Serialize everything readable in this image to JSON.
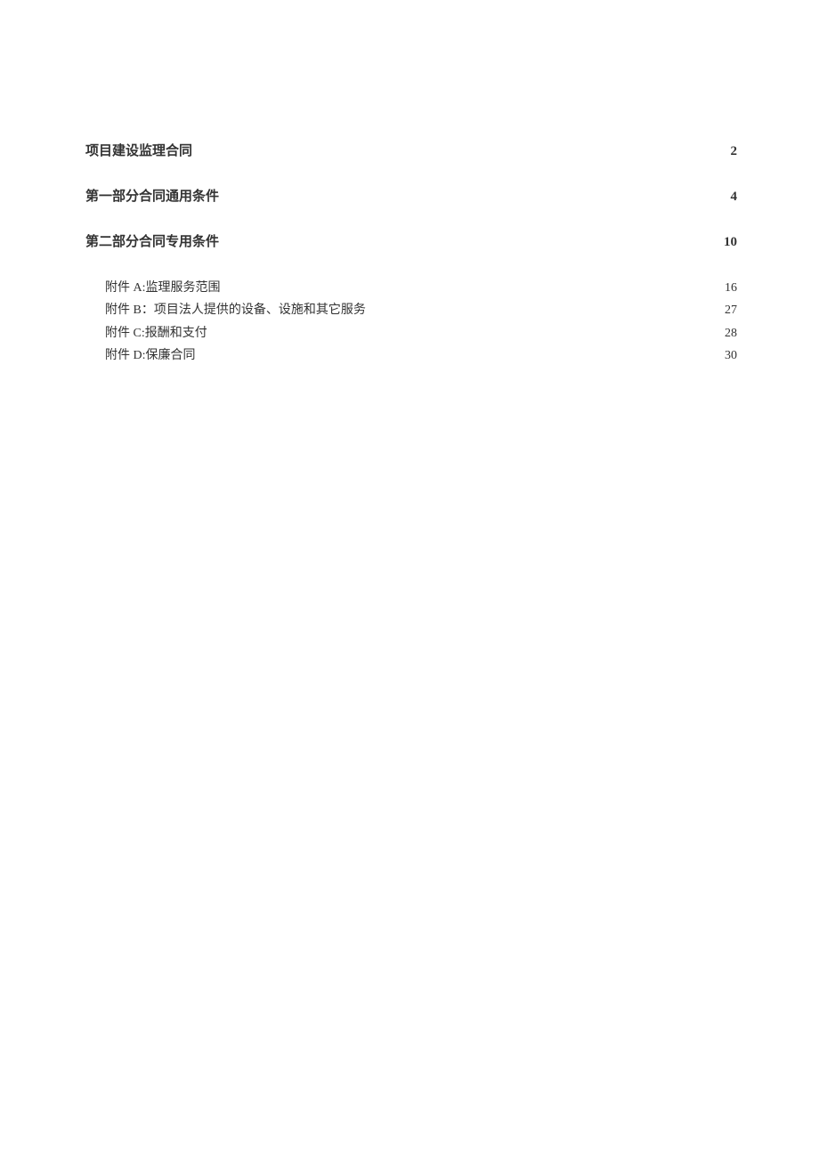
{
  "toc": {
    "main": [
      {
        "title": "项目建设监理合同",
        "page": "2"
      },
      {
        "title": "第一部分合同通用条件",
        "page": "4"
      },
      {
        "title": "第二部分合同专用条件",
        "page": "10"
      }
    ],
    "sub": [
      {
        "title": "附件 A:监理服务范围",
        "page": "16"
      },
      {
        "title": "附件 B：项目法人提供的设备、设施和其它服务",
        "page": "27"
      },
      {
        "title": "附件 C:报酬和支付",
        "page": "28"
      },
      {
        "title": "附件 D:保廉合同",
        "page": "30"
      }
    ]
  }
}
